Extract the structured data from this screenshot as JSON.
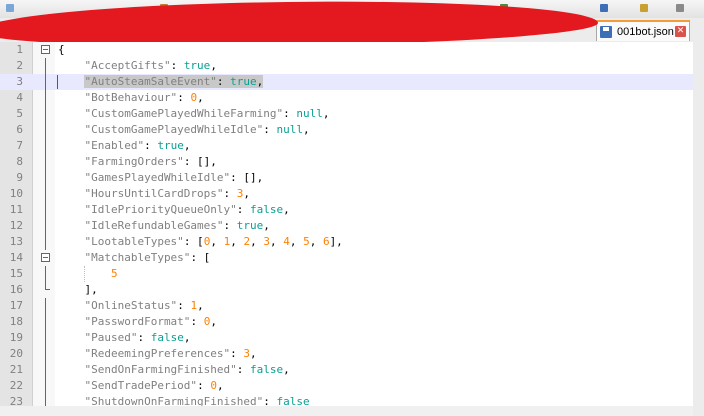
{
  "tab": {
    "title": "001bot.json"
  },
  "editor": {
    "lines": [
      {
        "n": "1",
        "indent": 0,
        "fold": "open",
        "parts": [
          {
            "t": "{",
            "c": "op"
          }
        ]
      },
      {
        "n": "2",
        "indent": 1,
        "fold": "guide",
        "parts": [
          {
            "t": "\"AcceptGifts\"",
            "c": "s"
          },
          {
            "t": ": ",
            "c": "op"
          },
          {
            "t": "true",
            "c": "kw"
          },
          {
            "t": ",",
            "c": "op"
          }
        ]
      },
      {
        "n": "3",
        "indent": 1,
        "fold": "guide",
        "current": true,
        "parts": [
          {
            "t": "\"AutoSteamSaleEvent\"",
            "c": "s hl"
          },
          {
            "t": ": ",
            "c": "op hl"
          },
          {
            "t": "true",
            "c": "kw hl"
          },
          {
            "t": ",",
            "c": "op hl"
          }
        ]
      },
      {
        "n": "4",
        "indent": 1,
        "fold": "guide",
        "parts": [
          {
            "t": "\"BotBehaviour\"",
            "c": "s"
          },
          {
            "t": ": ",
            "c": "op"
          },
          {
            "t": "0",
            "c": "num"
          },
          {
            "t": ",",
            "c": "op"
          }
        ]
      },
      {
        "n": "5",
        "indent": 1,
        "fold": "guide",
        "parts": [
          {
            "t": "\"CustomGamePlayedWhileFarming\"",
            "c": "s"
          },
          {
            "t": ": ",
            "c": "op"
          },
          {
            "t": "null",
            "c": "kw"
          },
          {
            "t": ",",
            "c": "op"
          }
        ]
      },
      {
        "n": "6",
        "indent": 1,
        "fold": "guide",
        "parts": [
          {
            "t": "\"CustomGamePlayedWhileIdle\"",
            "c": "s"
          },
          {
            "t": ": ",
            "c": "op"
          },
          {
            "t": "null",
            "c": "kw"
          },
          {
            "t": ",",
            "c": "op"
          }
        ]
      },
      {
        "n": "7",
        "indent": 1,
        "fold": "guide",
        "parts": [
          {
            "t": "\"Enabled\"",
            "c": "s"
          },
          {
            "t": ": ",
            "c": "op"
          },
          {
            "t": "true",
            "c": "kw"
          },
          {
            "t": ",",
            "c": "op"
          }
        ]
      },
      {
        "n": "8",
        "indent": 1,
        "fold": "guide",
        "parts": [
          {
            "t": "\"FarmingOrders\"",
            "c": "s"
          },
          {
            "t": ": [],",
            "c": "op"
          }
        ]
      },
      {
        "n": "9",
        "indent": 1,
        "fold": "guide",
        "parts": [
          {
            "t": "\"GamesPlayedWhileIdle\"",
            "c": "s"
          },
          {
            "t": ": [],",
            "c": "op"
          }
        ]
      },
      {
        "n": "10",
        "indent": 1,
        "fold": "guide",
        "parts": [
          {
            "t": "\"HoursUntilCardDrops\"",
            "c": "s"
          },
          {
            "t": ": ",
            "c": "op"
          },
          {
            "t": "3",
            "c": "num"
          },
          {
            "t": ",",
            "c": "op"
          }
        ]
      },
      {
        "n": "11",
        "indent": 1,
        "fold": "guide",
        "parts": [
          {
            "t": "\"IdlePriorityQueueOnly\"",
            "c": "s"
          },
          {
            "t": ": ",
            "c": "op"
          },
          {
            "t": "false",
            "c": "kw"
          },
          {
            "t": ",",
            "c": "op"
          }
        ]
      },
      {
        "n": "12",
        "indent": 1,
        "fold": "guide",
        "parts": [
          {
            "t": "\"IdleRefundableGames\"",
            "c": "s"
          },
          {
            "t": ": ",
            "c": "op"
          },
          {
            "t": "true",
            "c": "kw"
          },
          {
            "t": ",",
            "c": "op"
          }
        ]
      },
      {
        "n": "13",
        "indent": 1,
        "fold": "guide",
        "parts": [
          {
            "t": "\"LootableTypes\"",
            "c": "s"
          },
          {
            "t": ": [",
            "c": "op"
          },
          {
            "t": "0",
            "c": "num"
          },
          {
            "t": ", ",
            "c": "op"
          },
          {
            "t": "1",
            "c": "num"
          },
          {
            "t": ", ",
            "c": "op"
          },
          {
            "t": "2",
            "c": "num"
          },
          {
            "t": ", ",
            "c": "op"
          },
          {
            "t": "3",
            "c": "num"
          },
          {
            "t": ", ",
            "c": "op"
          },
          {
            "t": "4",
            "c": "num"
          },
          {
            "t": ", ",
            "c": "op"
          },
          {
            "t": "5",
            "c": "num"
          },
          {
            "t": ", ",
            "c": "op"
          },
          {
            "t": "6",
            "c": "num"
          },
          {
            "t": "],",
            "c": "op"
          }
        ]
      },
      {
        "n": "14",
        "indent": 1,
        "fold": "open",
        "parts": [
          {
            "t": "\"MatchableTypes\"",
            "c": "s"
          },
          {
            "t": ": [",
            "c": "op"
          }
        ]
      },
      {
        "n": "15",
        "indent": 2,
        "fold": "guide",
        "parts": [
          {
            "t": "5",
            "c": "num"
          }
        ]
      },
      {
        "n": "16",
        "indent": 1,
        "fold": "end",
        "parts": [
          {
            "t": "],",
            "c": "op"
          }
        ]
      },
      {
        "n": "17",
        "indent": 1,
        "fold": "guide",
        "parts": [
          {
            "t": "\"OnlineStatus\"",
            "c": "s"
          },
          {
            "t": ": ",
            "c": "op"
          },
          {
            "t": "1",
            "c": "num"
          },
          {
            "t": ",",
            "c": "op"
          }
        ]
      },
      {
        "n": "18",
        "indent": 1,
        "fold": "guide",
        "parts": [
          {
            "t": "\"PasswordFormat\"",
            "c": "s"
          },
          {
            "t": ": ",
            "c": "op"
          },
          {
            "t": "0",
            "c": "num"
          },
          {
            "t": ",",
            "c": "op"
          }
        ]
      },
      {
        "n": "19",
        "indent": 1,
        "fold": "guide",
        "parts": [
          {
            "t": "\"Paused\"",
            "c": "s"
          },
          {
            "t": ": ",
            "c": "op"
          },
          {
            "t": "false",
            "c": "kw"
          },
          {
            "t": ",",
            "c": "op"
          }
        ]
      },
      {
        "n": "20",
        "indent": 1,
        "fold": "guide",
        "parts": [
          {
            "t": "\"RedeemingPreferences\"",
            "c": "s"
          },
          {
            "t": ": ",
            "c": "op"
          },
          {
            "t": "3",
            "c": "num"
          },
          {
            "t": ",",
            "c": "op"
          }
        ]
      },
      {
        "n": "21",
        "indent": 1,
        "fold": "guide",
        "parts": [
          {
            "t": "\"SendOnFarmingFinished\"",
            "c": "s"
          },
          {
            "t": ": ",
            "c": "op"
          },
          {
            "t": "false",
            "c": "kw"
          },
          {
            "t": ",",
            "c": "op"
          }
        ]
      },
      {
        "n": "22",
        "indent": 1,
        "fold": "guide",
        "parts": [
          {
            "t": "\"SendTradePeriod\"",
            "c": "s"
          },
          {
            "t": ": ",
            "c": "op"
          },
          {
            "t": "0",
            "c": "num"
          },
          {
            "t": ",",
            "c": "op"
          }
        ]
      },
      {
        "n": "23",
        "indent": 1,
        "fold": "guide",
        "parts": [
          {
            "t": "\"ShutdownOnFarmingFinished\"",
            "c": "s"
          },
          {
            "t": ": ",
            "c": "op"
          },
          {
            "t": "false",
            "c": "kw"
          }
        ]
      }
    ]
  },
  "colors": {
    "string": "#808080",
    "keyword": "#0aa093",
    "number": "#ff8000",
    "current_line": "#e8e8ff",
    "fold_marker": "#e03030",
    "redaction": "#e3191f"
  },
  "icons": {
    "tab_icon": "save-icon",
    "tab_close": "close-icon",
    "fold_marker": "minus-box-icon"
  }
}
